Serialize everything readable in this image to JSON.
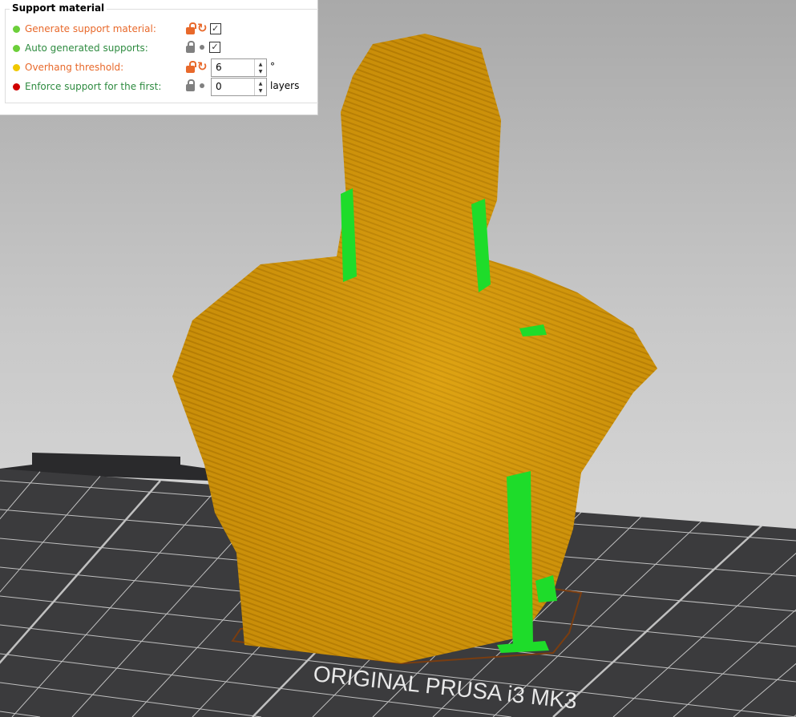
{
  "panel": {
    "title": "Support material",
    "rows": [
      {
        "label": "Generate support material:",
        "label_color": "#e8692b",
        "dot_color": "#6ccf3a",
        "modified": true,
        "control": "checkbox",
        "checked": true,
        "check": "✓"
      },
      {
        "label": "Auto generated supports:",
        "label_color": "#2e8b40",
        "dot_color": "#6ccf3a",
        "modified": false,
        "control": "checkbox",
        "checked": true,
        "check": "✓"
      },
      {
        "label": "Overhang threshold:",
        "label_color": "#e8692b",
        "dot_color": "#f0c800",
        "modified": true,
        "control": "spin",
        "value": "6",
        "unit": "°"
      },
      {
        "label": "Enforce support for the first:",
        "label_color": "#2e8b40",
        "dot_color": "#d00000",
        "modified": false,
        "control": "spin",
        "value": "0",
        "unit": "layers"
      }
    ],
    "undo_glyph": "↻",
    "spin_up": "▲",
    "spin_down": "▼"
  },
  "viewport": {
    "bed_label": "ORIGINAL PRUSA i3 MK3",
    "model_color": "#d69a0c",
    "support_color": "#1edc2a",
    "bed_color": "#3b3b3d"
  }
}
